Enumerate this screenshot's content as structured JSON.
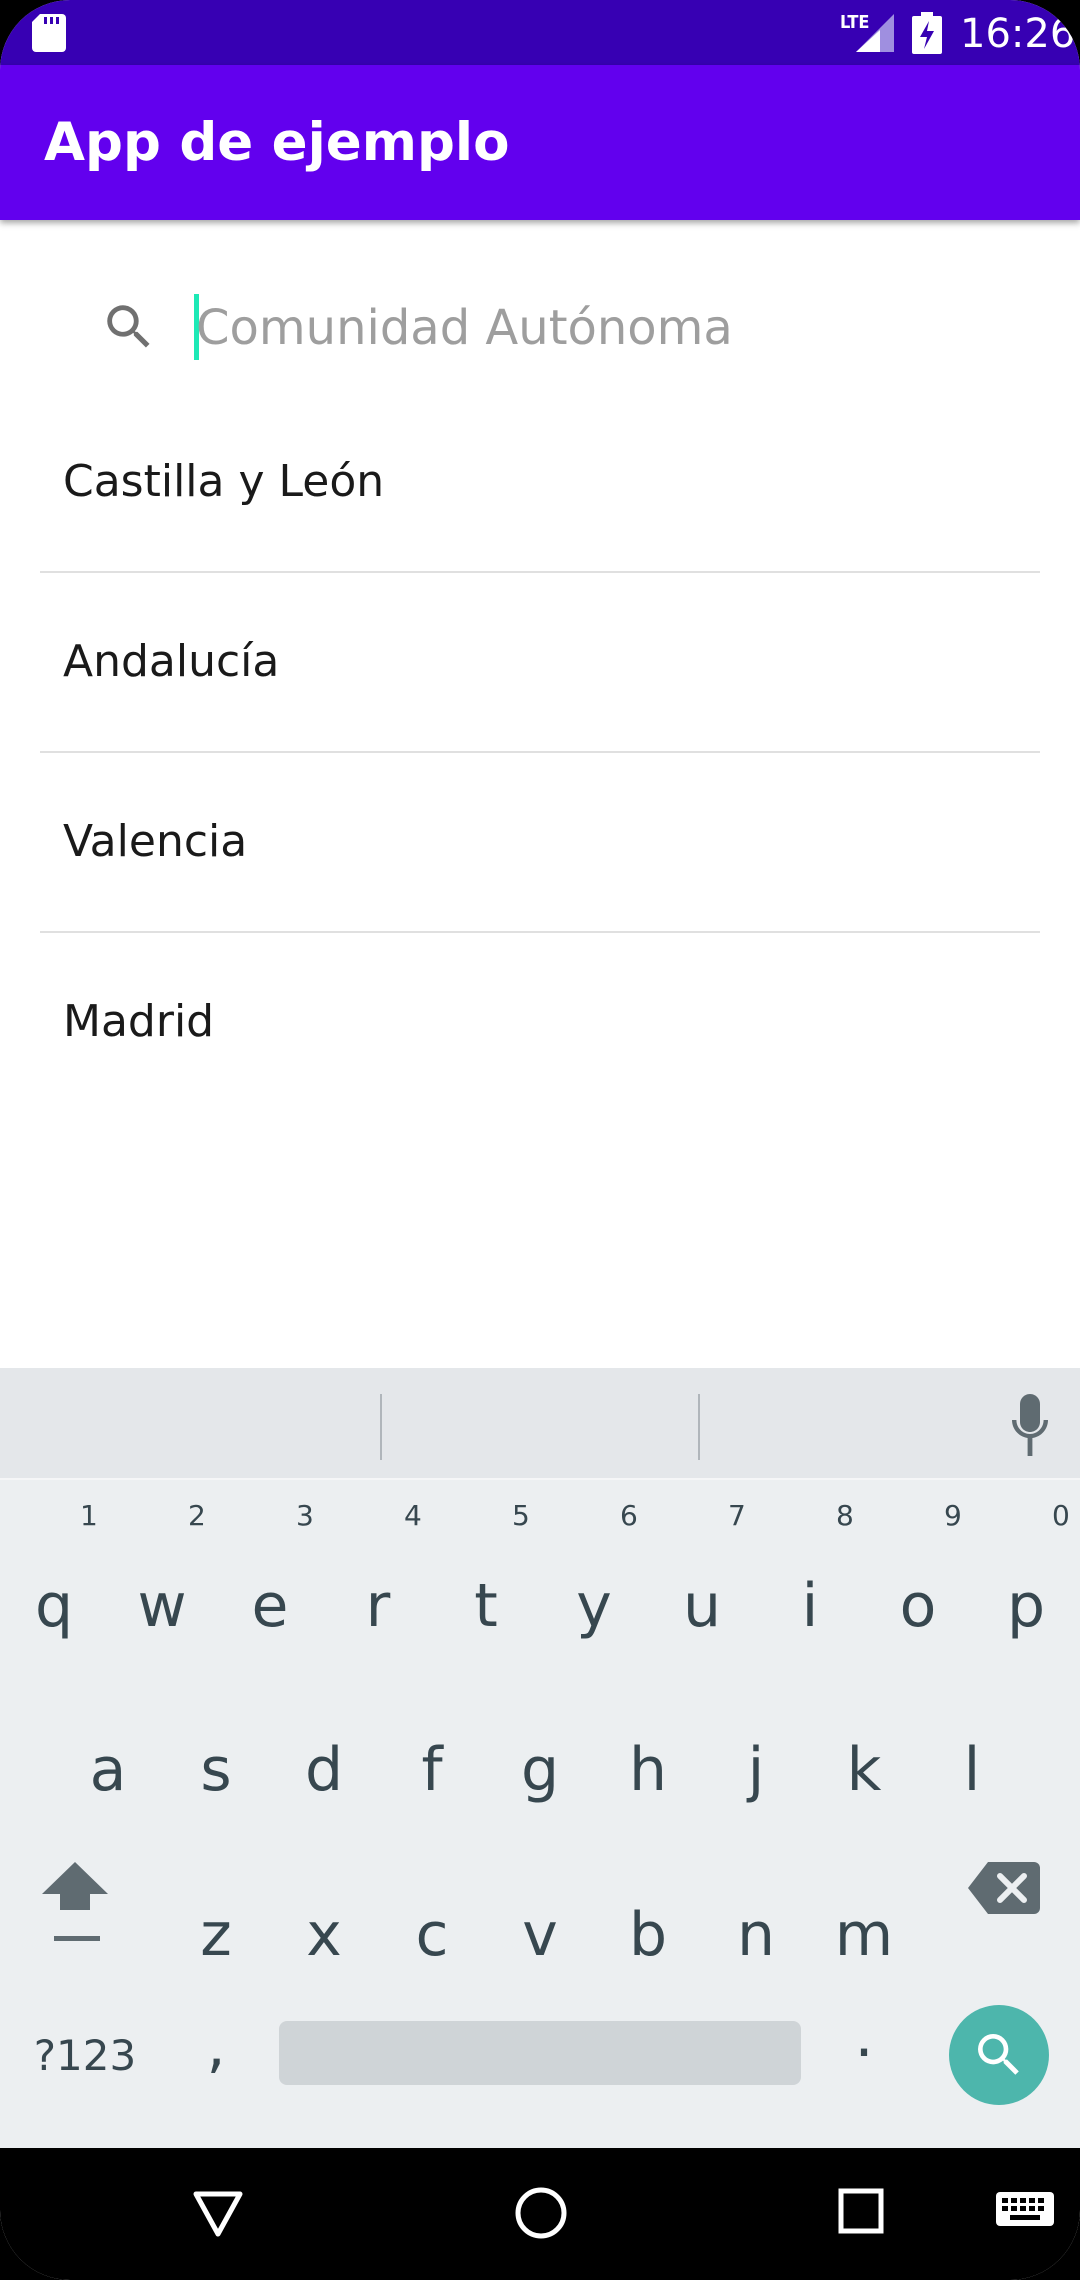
{
  "status_bar": {
    "network": "LTE",
    "time": "16:26"
  },
  "app_bar": {
    "title": "App de ejemplo"
  },
  "search": {
    "placeholder": "Comunidad Autónoma",
    "value": ""
  },
  "list": {
    "items": [
      {
        "label": "Castilla y León"
      },
      {
        "label": "Andalucía"
      },
      {
        "label": "Valencia"
      },
      {
        "label": "Madrid"
      }
    ]
  },
  "keyboard": {
    "row1": [
      "q",
      "w",
      "e",
      "r",
      "t",
      "y",
      "u",
      "i",
      "o",
      "p"
    ],
    "row1_hints": [
      "1",
      "2",
      "3",
      "4",
      "5",
      "6",
      "7",
      "8",
      "9",
      "0"
    ],
    "row2": [
      "a",
      "s",
      "d",
      "f",
      "g",
      "h",
      "j",
      "k",
      "l"
    ],
    "row3": [
      "z",
      "x",
      "c",
      "v",
      "b",
      "n",
      "m"
    ],
    "symbols_label": "?123",
    "comma": ",",
    "period": "."
  },
  "icons": {
    "search": "search-icon",
    "mic": "mic-icon",
    "shift": "shift-icon",
    "backspace": "backspace-icon",
    "keyboard_action": "search-action-icon",
    "nav_back": "nav-back-icon",
    "nav_home": "nav-home-icon",
    "nav_recents": "nav-recents-icon",
    "nav_keyboard": "keyboard-icon"
  },
  "colors": {
    "status_bar": "#3700b3",
    "app_bar": "#6200ee",
    "cursor": "#1de9b6",
    "keyboard_action": "#4db6ac"
  }
}
